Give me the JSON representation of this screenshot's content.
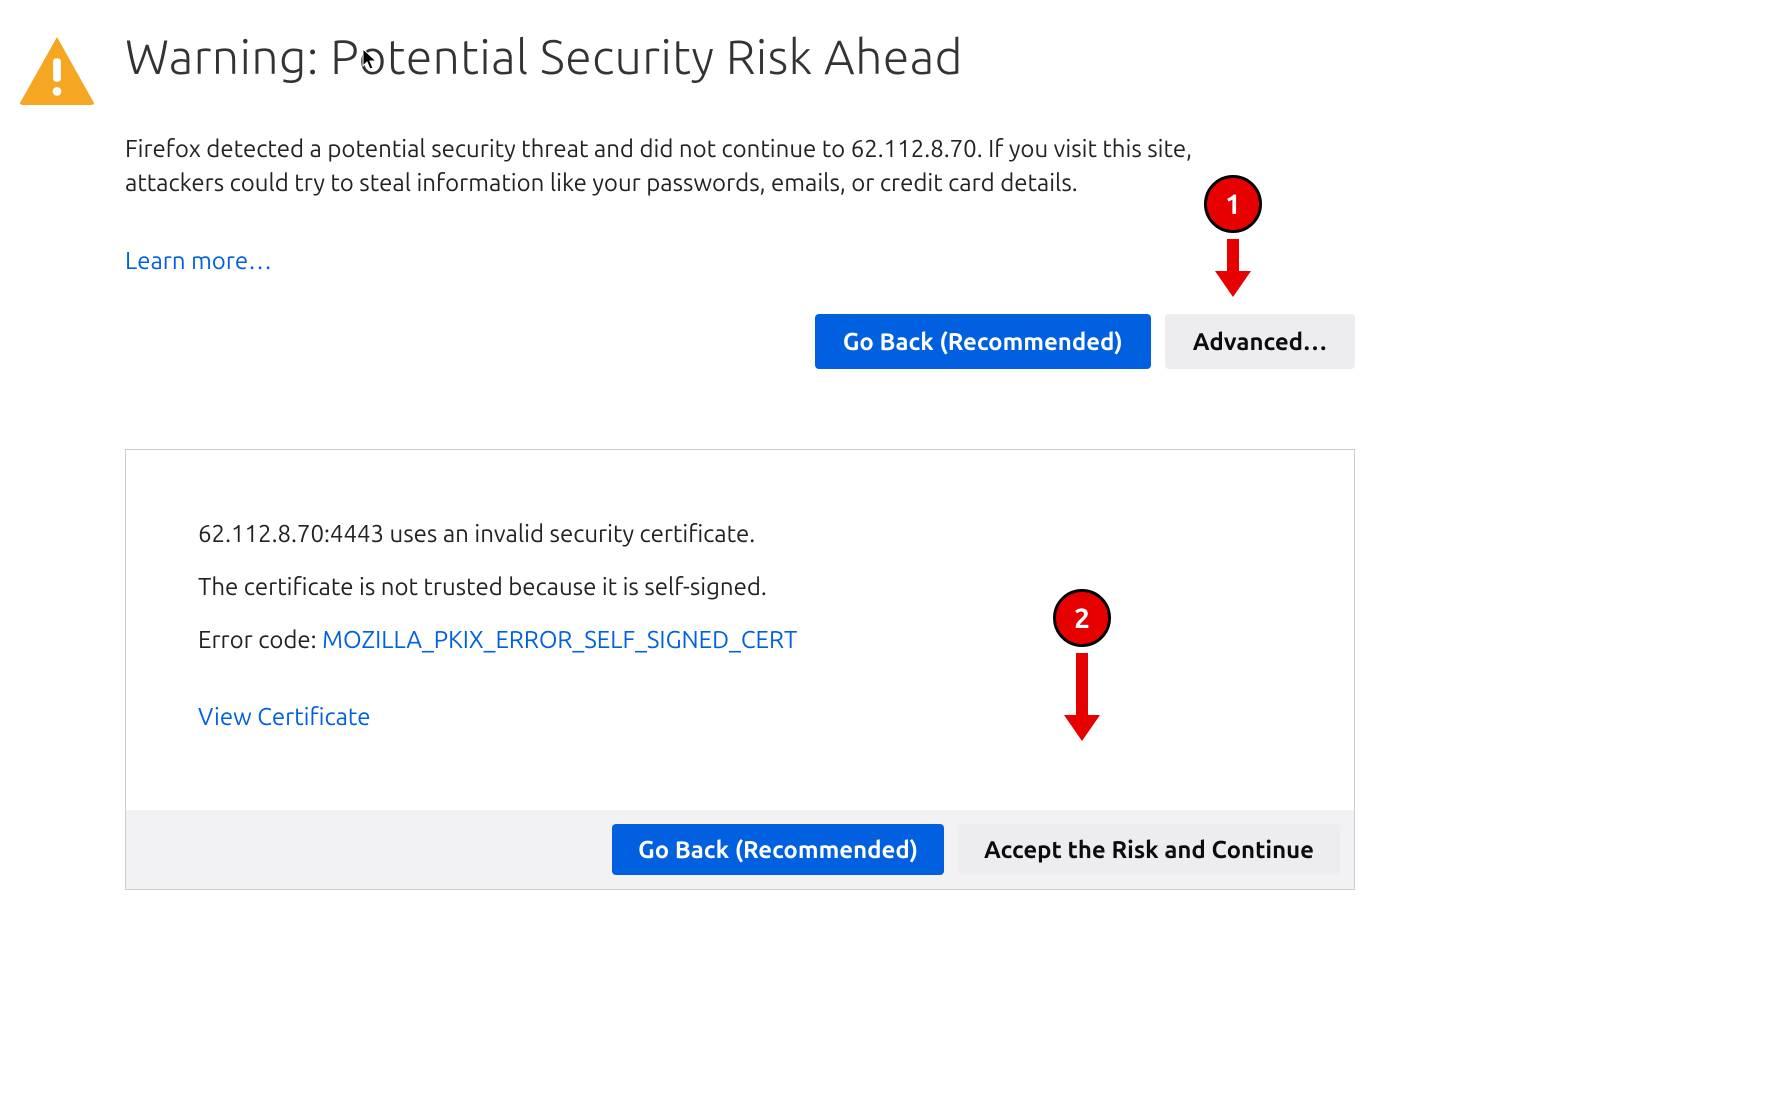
{
  "warning": {
    "title": "Warning: Potential Security Risk Ahead",
    "description": "Firefox detected a potential security threat and did not continue to 62.112.8.70. If you visit this site, attackers could try to steal information like your passwords, emails, or credit card details.",
    "learn_more": "Learn more…",
    "go_back": "Go Back (Recommended)",
    "advanced": "Advanced…"
  },
  "advanced_panel": {
    "invalid_cert": "62.112.8.70:4443 uses an invalid security certificate.",
    "not_trusted": "The certificate is not trusted because it is self-signed.",
    "error_code_label": "Error code: ",
    "error_code": "MOZILLA_PKIX_ERROR_SELF_SIGNED_CERT",
    "view_certificate": "View Certificate",
    "go_back": "Go Back (Recommended)",
    "accept": "Accept the Risk and Continue"
  },
  "annotations": {
    "step1": "1",
    "step2": "2"
  }
}
